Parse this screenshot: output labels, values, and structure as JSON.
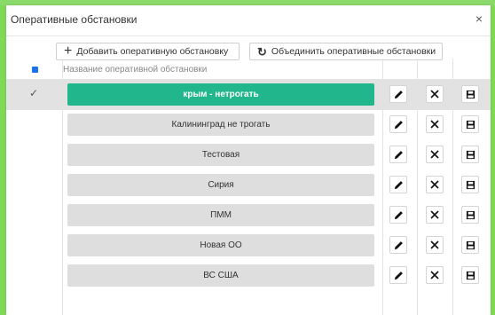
{
  "dialog": {
    "title": "Оперативные обстановки",
    "close_label": "×"
  },
  "toolbar": {
    "add_label": "Добавить оперативную обстановку",
    "add_icon": "+",
    "merge_label": "Объединить оперативные обстановки",
    "merge_icon": "↻"
  },
  "table": {
    "header_name": "Название оперативной обстановки",
    "rows": [
      {
        "name": "крым - нетрогать",
        "selected": true
      },
      {
        "name": "Калининград не трогать",
        "selected": false
      },
      {
        "name": "Тестовая",
        "selected": false
      },
      {
        "name": "Сирия",
        "selected": false
      },
      {
        "name": "ПММ",
        "selected": false
      },
      {
        "name": "Новая ОО",
        "selected": false
      },
      {
        "name": "ВС США",
        "selected": false
      }
    ]
  },
  "colors": {
    "accent": "#21b68c",
    "checkbox": "#1a73e8",
    "backdrop": "#7ed957"
  }
}
